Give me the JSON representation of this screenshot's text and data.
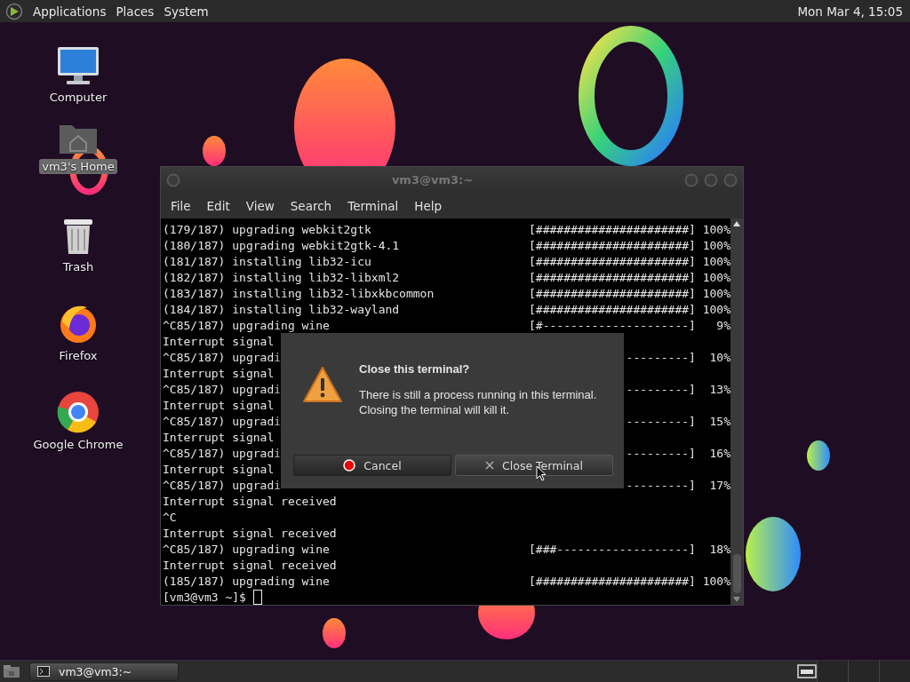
{
  "top_panel": {
    "menus": [
      "Applications",
      "Places",
      "System"
    ],
    "clock": "Mon Mar 4, 15:05"
  },
  "desktop_icons": [
    {
      "label": "Computer",
      "kind": "computer",
      "selected": false
    },
    {
      "label": "vm3's Home",
      "kind": "home",
      "selected": true
    },
    {
      "label": "Trash",
      "kind": "trash",
      "selected": false
    },
    {
      "label": "Firefox",
      "kind": "firefox",
      "selected": false
    },
    {
      "label": "Google Chrome",
      "kind": "chrome",
      "selected": false
    }
  ],
  "terminal": {
    "title": "vm3@vm3:~",
    "menu": [
      "File",
      "Edit",
      "View",
      "Search",
      "Terminal",
      "Help"
    ],
    "lines": [
      {
        "text": "(179/187) upgrading webkit2gtk",
        "progress": "[######################] 100%"
      },
      {
        "text": "(180/187) upgrading webkit2gtk-4.1",
        "progress": "[######################] 100%"
      },
      {
        "text": "(181/187) installing lib32-icu",
        "progress": "[######################] 100%"
      },
      {
        "text": "(182/187) installing lib32-libxml2",
        "progress": "[######################] 100%"
      },
      {
        "text": "(183/187) installing lib32-libxkbcommon",
        "progress": "[######################] 100%"
      },
      {
        "text": "(184/187) installing lib32-wayland",
        "progress": "[######################] 100%"
      },
      {
        "text": "^C85/187) upgrading wine",
        "progress": "[#---------------------]   9%"
      },
      {
        "text": "Interrupt signal"
      },
      {
        "text": "^C85/187) upgradi",
        "progress": "---------]  10%"
      },
      {
        "text": "Interrupt signal"
      },
      {
        "text": "^C85/187) upgradi",
        "progress": "---------]  13%"
      },
      {
        "text": "Interrupt signal"
      },
      {
        "text": "^C85/187) upgradi",
        "progress": "---------]  15%"
      },
      {
        "text": "Interrupt signal"
      },
      {
        "text": "^C85/187) upgradi",
        "progress": "---------]  16%"
      },
      {
        "text": "Interrupt signal"
      },
      {
        "text": "^C85/187) upgradi",
        "progress": "---------]  17%"
      },
      {
        "text": "Interrupt signal received"
      },
      {
        "text": "^C"
      },
      {
        "text": "Interrupt signal received"
      },
      {
        "text": "^C85/187) upgrading wine",
        "progress": "[###-------------------]  18%"
      },
      {
        "text": "Interrupt signal received"
      },
      {
        "text": "(185/187) upgrading wine",
        "progress": "[######################] 100%"
      }
    ],
    "prompt": "[vm3@vm3 ~]$"
  },
  "dialog": {
    "title": "Close this terminal?",
    "message": "There is still a process running in this terminal.\nClosing the terminal will kill it.",
    "buttons": [
      {
        "label": "Cancel",
        "kind": "cancel",
        "hovered": false
      },
      {
        "label": "Close Terminal",
        "kind": "close",
        "hovered": true
      }
    ]
  },
  "taskbar": {
    "tasks": [
      {
        "label": "vm3@vm3:~"
      }
    ]
  }
}
